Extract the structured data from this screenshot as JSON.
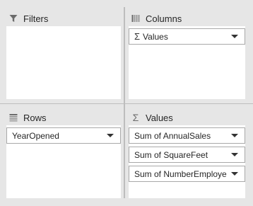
{
  "filters": {
    "title": "Filters",
    "icon": "filter-icon"
  },
  "columns": {
    "title": "Columns",
    "icon": "columns-icon",
    "fields": [
      {
        "label": "Values"
      }
    ]
  },
  "rows": {
    "title": "Rows",
    "icon": "rows-icon",
    "fields": [
      {
        "label": "YearOpened"
      }
    ]
  },
  "values": {
    "title": "Values",
    "icon": "sigma-icon",
    "fields": [
      {
        "label": "Sum of AnnualSales"
      },
      {
        "label": "Sum of SquareFeet"
      },
      {
        "label": "Sum of NumberEmployees"
      }
    ]
  }
}
